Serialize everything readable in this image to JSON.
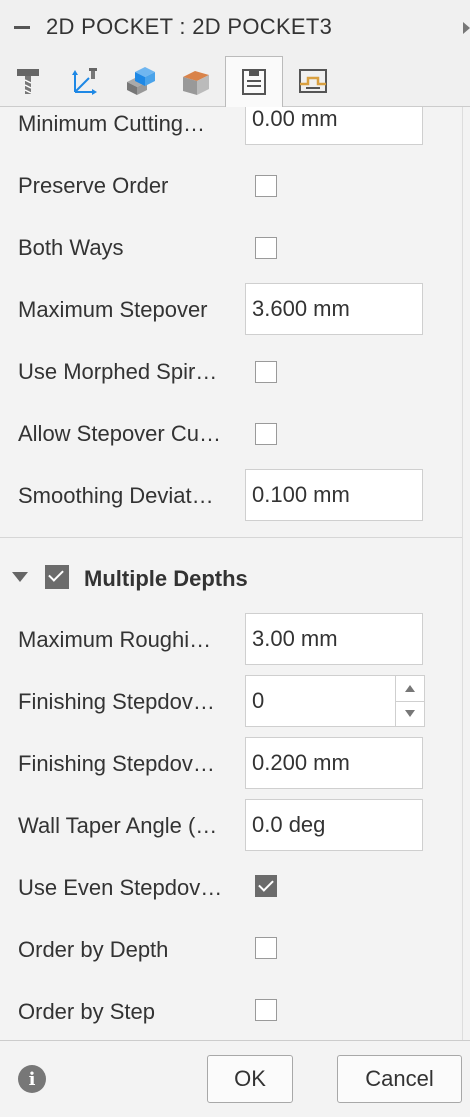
{
  "title": "2D POCKET : 2D POCKET3",
  "tabs": [
    {
      "name": "tool",
      "icon": "tool-icon"
    },
    {
      "name": "geometry",
      "icon": "axes-icon"
    },
    {
      "name": "heights",
      "icon": "heights-icon"
    },
    {
      "name": "passes-stock",
      "icon": "stock-icon"
    },
    {
      "name": "passes",
      "icon": "passes-icon",
      "active": true
    },
    {
      "name": "linking",
      "icon": "linking-icon"
    }
  ],
  "rows": {
    "min_cutting": {
      "label": "Minimum Cutting…",
      "value": "0.00 mm"
    },
    "preserve_order": {
      "label": "Preserve Order",
      "checked": false
    },
    "both_ways": {
      "label": "Both Ways",
      "checked": false
    },
    "max_stepover": {
      "label": "Maximum Stepover",
      "value": "3.600 mm"
    },
    "morphed_spiral": {
      "label": "Use Morphed Spir…",
      "checked": false
    },
    "allow_stepover": {
      "label": "Allow Stepover Cu…",
      "checked": false
    },
    "smoothing": {
      "label": "Smoothing Deviat…",
      "value": "0.100 mm"
    }
  },
  "section": {
    "title": "Multiple Depths",
    "checked": true
  },
  "depth_rows": {
    "max_roughing": {
      "label": "Maximum Roughi…",
      "value": "3.00 mm"
    },
    "finishing_stepdowns": {
      "label": "Finishing Stepdov…",
      "value": "0"
    },
    "finishing_stepdown": {
      "label": "Finishing Stepdov…",
      "value": "0.200 mm"
    },
    "wall_taper": {
      "label": "Wall Taper Angle (…",
      "value": "0.0 deg"
    },
    "even_stepdowns": {
      "label": "Use Even Stepdov…",
      "checked": true
    },
    "order_by_depth": {
      "label": "Order by Depth",
      "checked": false
    },
    "order_by_step": {
      "label": "Order by Step",
      "checked": false
    }
  },
  "footer": {
    "ok": "OK",
    "cancel": "Cancel",
    "info": "i"
  },
  "colors": {
    "accent_blue": "#1e88e5",
    "accent_orange": "#d9834a",
    "check_fill": "#6b6b6b"
  }
}
